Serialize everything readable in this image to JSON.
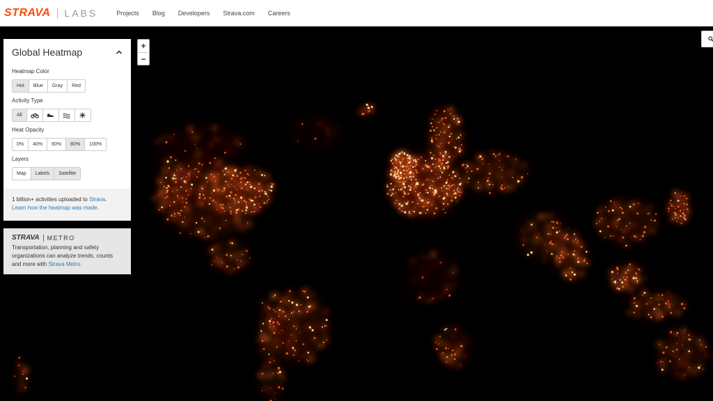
{
  "header": {
    "brand": "STRAVA",
    "sub_brand": "LABS",
    "nav": [
      "Projects",
      "Blog",
      "Developers",
      "Strava.com",
      "Careers"
    ]
  },
  "map": {
    "zoom_in": "+",
    "zoom_out": "−",
    "colors": {
      "background": "#000000",
      "hot_low": "#7a1a0a",
      "hot_mid": "#e8631c",
      "hot_high": "#ffe9a6"
    }
  },
  "panel": {
    "title": "Global Heatmap",
    "heatmap_color": {
      "label": "Heatmap Color",
      "options": [
        "Hot",
        "Blue",
        "Gray",
        "Red"
      ],
      "selected": "Hot"
    },
    "activity_type": {
      "label": "Activity Type",
      "options": [
        "All",
        "bike-icon",
        "run-icon",
        "water-icon",
        "winter-icon"
      ],
      "selected": "All"
    },
    "heat_opacity": {
      "label": "Heat Opacity",
      "options": [
        "0%",
        "40%",
        "60%",
        "80%",
        "100%"
      ],
      "selected": "80%"
    },
    "layers": {
      "label": "Layers",
      "options": [
        "Map",
        "Labels",
        "Satellite"
      ],
      "selected": [
        "Labels",
        "Satellite"
      ]
    },
    "info_text_1": "1 billion+ activities uploaded to ",
    "info_link_1": "Strava",
    "info_text_2": ".",
    "info_link_2": "Learn how the heatmap was made",
    "info_text_3": "."
  },
  "metro": {
    "brand": "STRAVA",
    "product": "METRO",
    "text": "Transportation, planning and safety organizations can analyze trends, counts and more with ",
    "link": "Strava Metro",
    "text_end": "."
  }
}
